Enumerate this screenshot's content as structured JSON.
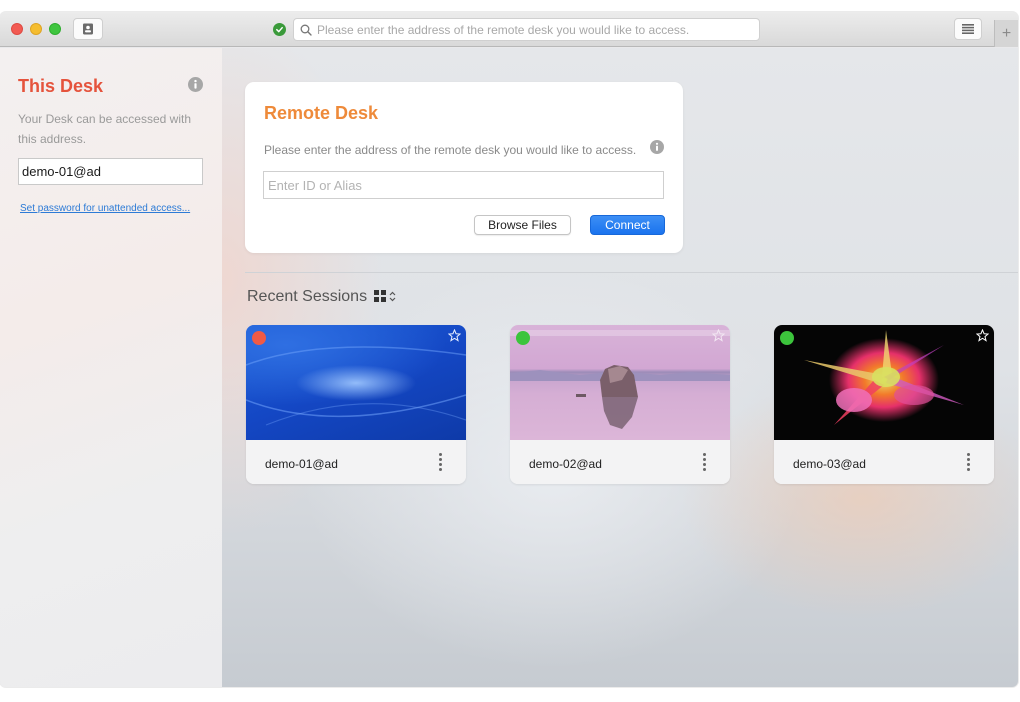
{
  "titlebar": {
    "status": "connected",
    "address_placeholder": "Please enter the address of the remote desk you would like to access.",
    "icons": {
      "contact": "contact-card-icon",
      "status": "check-circle-icon",
      "search": "search-icon",
      "menu": "list-menu-icon",
      "new_tab": "plus-icon"
    },
    "new_tab_label": "+"
  },
  "sidebar": {
    "title": "This Desk",
    "description": "Your Desk can be accessed with this address.",
    "address_value": "demo-01@ad",
    "password_link": "Set password for unattended access..."
  },
  "remote_desk": {
    "title": "Remote Desk",
    "description": "Please enter the address of the remote desk you would like to access.",
    "input_placeholder": "Enter ID or Alias",
    "input_value": "",
    "browse_label": "Browse Files",
    "connect_label": "Connect"
  },
  "recent": {
    "title": "Recent Sessions",
    "view_mode": "grid",
    "sessions": [
      {
        "name": "demo-01@ad",
        "status": "offline",
        "status_color": "#ef5a45",
        "favorite": false,
        "thumbnail": "blue-wave-wallpaper"
      },
      {
        "name": "demo-02@ad",
        "status": "online",
        "status_color": "#3cc43c",
        "favorite": false,
        "thumbnail": "pink-lake-rock-wallpaper"
      },
      {
        "name": "demo-03@ad",
        "status": "online",
        "status_color": "#3cc43c",
        "favorite": false,
        "thumbnail": "color-powder-explosion-wallpaper"
      }
    ]
  },
  "colors": {
    "this_desk_accent": "#e5533c",
    "remote_desk_accent": "#ee8a3a",
    "connect_button": "#1a73ee",
    "link": "#2d7bd6"
  }
}
